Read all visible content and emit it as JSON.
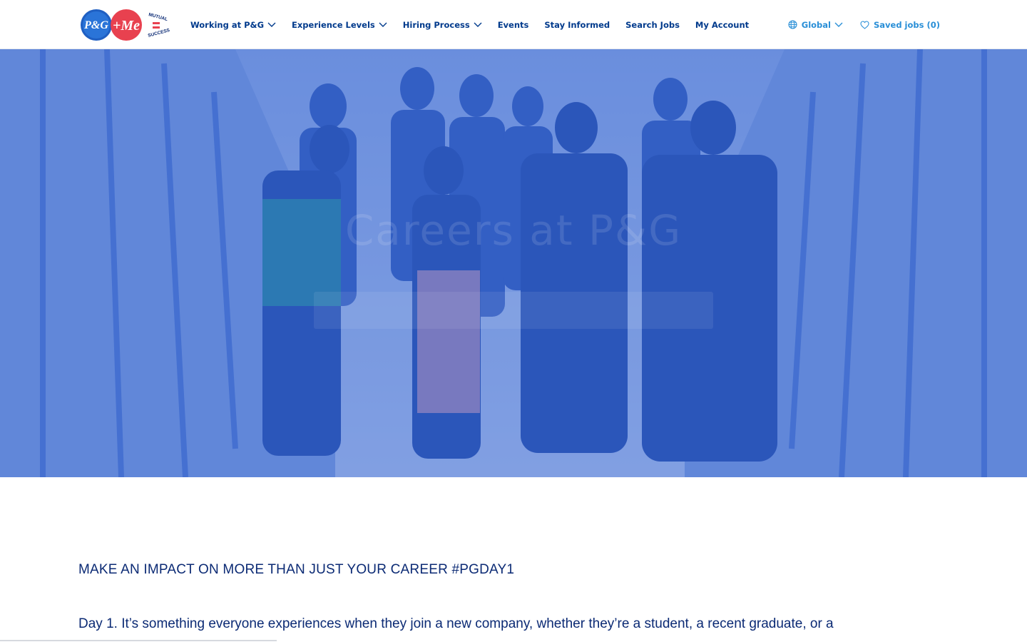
{
  "header": {
    "logo": {
      "brand": "P&G",
      "plus": "+Me",
      "tagline": "MUTUAL SUCCESS"
    },
    "nav": [
      {
        "label": "Working at P&G",
        "has_dropdown": true
      },
      {
        "label": "Experience Levels",
        "has_dropdown": true
      },
      {
        "label": "Hiring Process",
        "has_dropdown": true
      },
      {
        "label": "Events",
        "has_dropdown": false
      },
      {
        "label": "Stay Informed",
        "has_dropdown": false
      },
      {
        "label": "Search Jobs",
        "has_dropdown": false
      },
      {
        "label": "My Account",
        "has_dropdown": false
      }
    ],
    "region": {
      "label": "Global",
      "icon": "globe-icon"
    },
    "saved": {
      "label": "Saved jobs (0)",
      "icon": "heart-icon"
    }
  },
  "hero": {
    "title": "Careers at P&G",
    "overlay_color": "#2a60d2"
  },
  "article": {
    "headline": "MAKE AN IMPACT ON MORE THAN JUST YOUR CAREER #PGDAY1",
    "paragraph": "Day 1. It’s something everyone experiences when they join a new company, whether they’re a student, a recent graduate, or a"
  },
  "colors": {
    "nav_text": "#003a8c",
    "accent": "#2a8fd7",
    "body_text": "#0b2a74"
  }
}
